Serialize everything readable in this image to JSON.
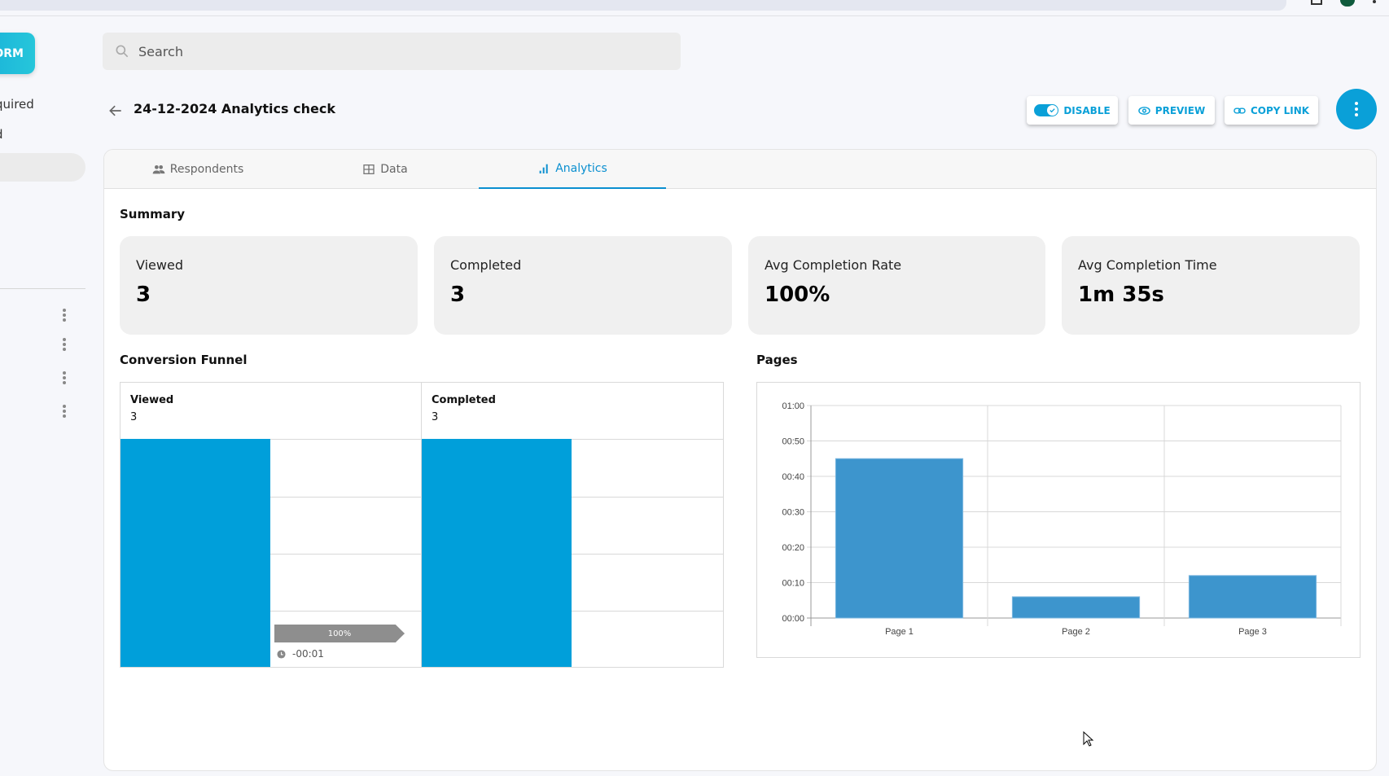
{
  "browser": {
    "url_fragment": "...forms/..."
  },
  "sidebar": {
    "new_form_label": "ORM",
    "items": [
      {
        "label": "quired"
      },
      {
        "label": "d"
      }
    ]
  },
  "search": {
    "placeholder": "Search",
    "value": ""
  },
  "header": {
    "title": "24-12-2024 Analytics check",
    "buttons": {
      "disable": "DISABLE",
      "preview": "PREVIEW",
      "copy_link": "COPY LINK"
    },
    "toggle_enabled": true
  },
  "tabs": [
    {
      "label": "Respondents",
      "icon": "people-icon",
      "active": false
    },
    {
      "label": "Data",
      "icon": "table-icon",
      "active": false
    },
    {
      "label": "Analytics",
      "icon": "bar-chart-icon",
      "active": true
    }
  ],
  "summary": {
    "title": "Summary",
    "cards": [
      {
        "label": "Viewed",
        "value": "3"
      },
      {
        "label": "Completed",
        "value": "3"
      },
      {
        "label": "Avg Completion Rate",
        "value": "100%"
      },
      {
        "label": "Avg Completion Time",
        "value": "1m 35s"
      }
    ]
  },
  "funnel": {
    "title": "Conversion Funnel",
    "steps": [
      {
        "label": "Viewed",
        "value": "3",
        "fraction": 1.0
      },
      {
        "label": "Completed",
        "value": "3",
        "fraction": 1.0
      }
    ],
    "conversion_rate": "100%",
    "conversion_time": "-00:01"
  },
  "pages": {
    "title": "Pages"
  },
  "colors": {
    "accent": "#0aa0d8",
    "funnel_bar": "#009fda",
    "pages_bar": "#3d95cd",
    "card_bg": "#f0f0f0"
  },
  "chart_data": {
    "type": "bar",
    "title": "Pages",
    "categories": [
      "Page 1",
      "Page 2",
      "Page 3"
    ],
    "values": [
      45,
      6,
      12
    ],
    "value_unit": "seconds",
    "ylim": [
      0,
      60
    ],
    "yticks": [
      0,
      10,
      20,
      30,
      40,
      50,
      60
    ],
    "ytick_labels": [
      "00:00",
      "00:10",
      "00:20",
      "00:30",
      "00:40",
      "00:50",
      "01:00"
    ],
    "xlabel": "",
    "ylabel": "",
    "grid": true,
    "legend": "none"
  }
}
